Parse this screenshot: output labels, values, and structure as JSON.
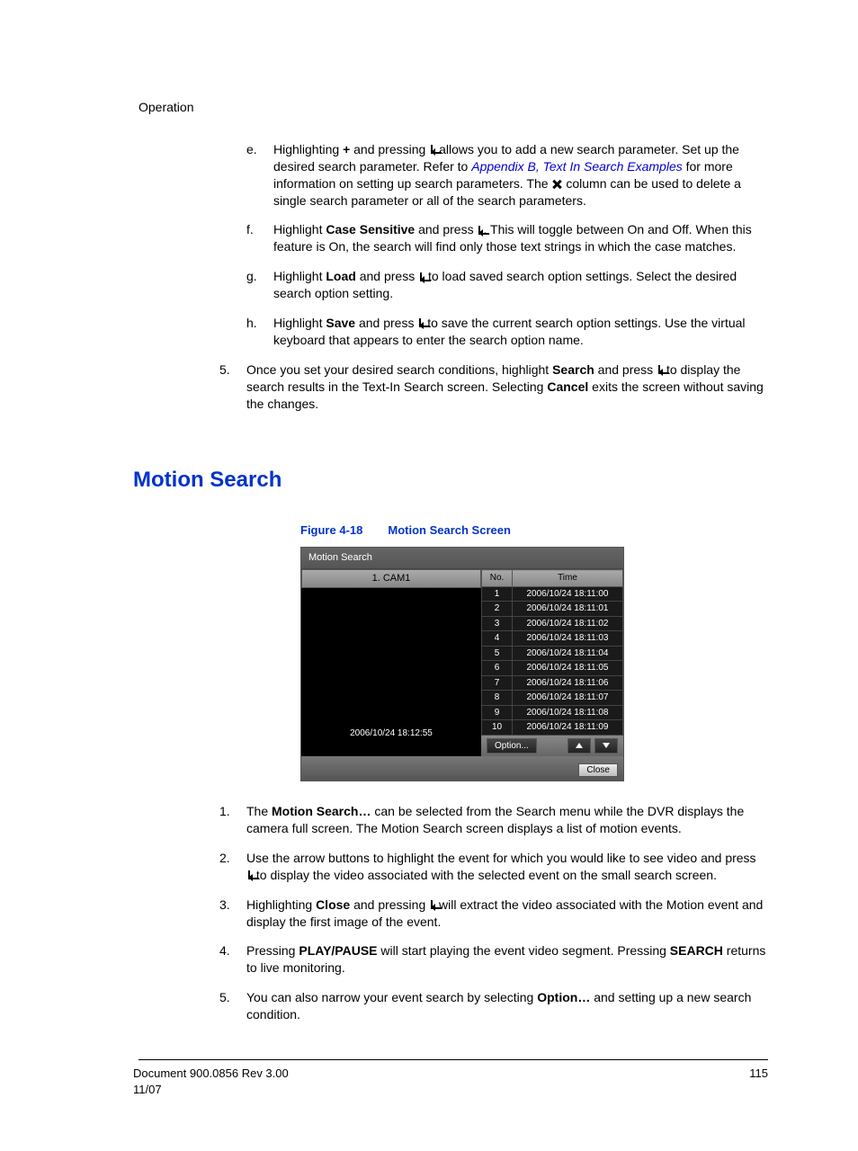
{
  "header": {
    "section": "Operation"
  },
  "top_sub_items": [
    {
      "marker": "e.",
      "pre": "Highlighting ",
      "bold1": "+",
      "mid1": " and pressing ",
      "icon": "enter",
      "mid2": " allows you to add a new search parameter. Set up the desired search parameter. Refer to ",
      "link": "Appendix B, Text In Search Examples",
      "mid3": " for more information on setting up search parameters. The ",
      "xicon": true,
      "tail": " column can be used to delete a single search parameter or all of the search parameters."
    },
    {
      "marker": "f.",
      "pre": "Highlight ",
      "bold1": "Case Sensitive",
      "mid1": " and press ",
      "icon": "enter",
      "tail": ". This will toggle between On and Off. When this feature is On, the search will find only those text strings in which the case matches."
    },
    {
      "marker": "g.",
      "pre": "Highlight ",
      "bold1": "Load",
      "mid1": " and press ",
      "icon": "enter",
      "tail": " to load saved search option settings. Select the desired search option setting."
    },
    {
      "marker": "h.",
      "pre": "Highlight ",
      "bold1": "Save",
      "mid1": " and press ",
      "icon": "enter",
      "tail": " to save the current search option settings. Use the virtual keyboard that appears to enter the search option name."
    }
  ],
  "top_num_item": {
    "marker": "5.",
    "pre": "Once you set your desired search conditions, highlight ",
    "bold1": "Search",
    "mid1": " and press ",
    "icon": "enter",
    "mid2": " to display the search results in the Text-In Search screen. Selecting ",
    "bold2": "Cancel",
    "tail": " exits the screen without saving the changes."
  },
  "heading": "Motion Search",
  "figure": {
    "label": "Figure 4-18",
    "title": "Motion Search Screen"
  },
  "screenshot": {
    "title": "Motion Search",
    "cam_label": "1. CAM1",
    "timestamp": "2006/10/24  18:12:55",
    "col_no": "No.",
    "col_time": "Time",
    "rows": [
      {
        "no": "1",
        "time": "2006/10/24  18:11:00"
      },
      {
        "no": "2",
        "time": "2006/10/24  18:11:01"
      },
      {
        "no": "3",
        "time": "2006/10/24  18:11:02"
      },
      {
        "no": "4",
        "time": "2006/10/24  18:11:03"
      },
      {
        "no": "5",
        "time": "2006/10/24  18:11:04"
      },
      {
        "no": "6",
        "time": "2006/10/24  18:11:05"
      },
      {
        "no": "7",
        "time": "2006/10/24  18:11:06"
      },
      {
        "no": "8",
        "time": "2006/10/24  18:11:07"
      },
      {
        "no": "9",
        "time": "2006/10/24  18:11:08"
      },
      {
        "no": "10",
        "time": "2006/10/24  18:11:09"
      }
    ],
    "option_btn": "Option...",
    "close_btn": "Close"
  },
  "bottom_items": [
    {
      "marker": "1.",
      "pre": "The ",
      "bold1": "Motion Search…",
      "tail": " can be selected from the Search menu while the DVR displays the camera full screen. The Motion Search screen displays a list of motion events."
    },
    {
      "marker": "2.",
      "pre": "Use the arrow buttons to highlight the event for which you would like to see video and press ",
      "icon": "enter",
      "tail": " to display the video associated with the selected event on the small search screen."
    },
    {
      "marker": "3.",
      "pre": "Highlighting ",
      "bold1": "Close",
      "mid1": " and pressing ",
      "icon": "enter",
      "tail": " will extract the video associated with the Motion event and display the first image of the event."
    },
    {
      "marker": "4.",
      "pre": "Pressing ",
      "bold1": "PLAY/PAUSE",
      "mid1": " will start playing the event video segment. Pressing ",
      "bold2": "SEARCH",
      "tail": " returns to live monitoring."
    },
    {
      "marker": "5.",
      "pre": "You can also narrow your event search by selecting ",
      "bold1": "Option…",
      "tail": " and setting up a new search condition."
    }
  ],
  "footer": {
    "doc": "Document 900.0856 Rev 3.00",
    "date": "11/07",
    "page": "115"
  }
}
